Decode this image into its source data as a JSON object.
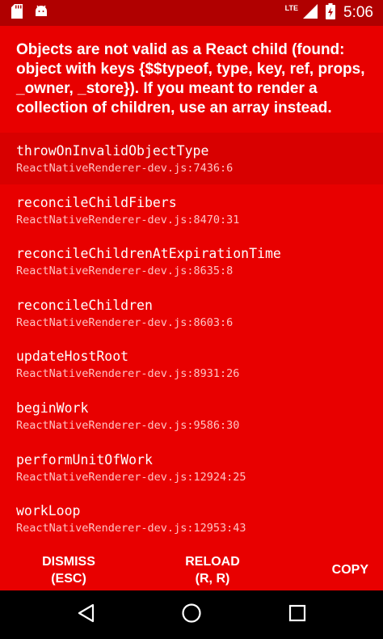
{
  "status_bar": {
    "network": "LTE",
    "time": "5:06",
    "icons": [
      "sd-card-icon",
      "android-icon",
      "lte-signal-icon",
      "battery-charging-icon"
    ]
  },
  "error": {
    "message": "Objects are not valid as a React child (found: object with keys {$$typeof, type, key, ref, props, _owner, _store}). If you meant to render a collection of children, use an array instead."
  },
  "stack": [
    {
      "method": "throwOnInvalidObjectType",
      "file": "ReactNativeRenderer-dev.js:7436:6"
    },
    {
      "method": "reconcileChildFibers",
      "file": "ReactNativeRenderer-dev.js:8470:31"
    },
    {
      "method": "reconcileChildrenAtExpirationTime",
      "file": "ReactNativeRenderer-dev.js:8635:8"
    },
    {
      "method": "reconcileChildren",
      "file": "ReactNativeRenderer-dev.js:8603:6"
    },
    {
      "method": "updateHostRoot",
      "file": "ReactNativeRenderer-dev.js:8931:26"
    },
    {
      "method": "beginWork",
      "file": "ReactNativeRenderer-dev.js:9586:30"
    },
    {
      "method": "performUnitOfWork",
      "file": "ReactNativeRenderer-dev.js:12924:25"
    },
    {
      "method": "workLoop",
      "file": "ReactNativeRenderer-dev.js:12953:43"
    }
  ],
  "buttons": {
    "dismiss_line1": "DISMISS",
    "dismiss_line2": "(ESC)",
    "reload_line1": "RELOAD",
    "reload_line2": "(R, R)",
    "copy": "COPY"
  },
  "colors": {
    "background": "#e80000",
    "status_bar": "#b00000",
    "highlight_row": "#d80000",
    "file_text": "#ffc2c2"
  }
}
